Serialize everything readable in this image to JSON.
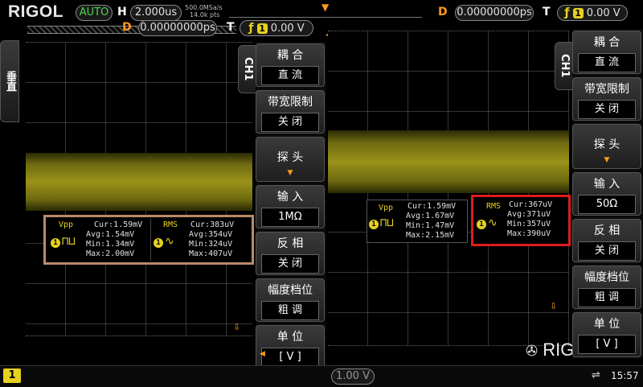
{
  "brand": "RIGOL",
  "top": {
    "mode": "AUTO",
    "h_label": "H",
    "h_value": "2.000us",
    "sample_rate": "500.0MSa/s",
    "mem_depth": "14.0k pts",
    "d_label": "D",
    "d_value": "0.00000000ps",
    "t_label": "T",
    "trig_channel": "1",
    "trig_level": "0.00 V"
  },
  "left_top": {
    "d_label": "D",
    "d_value": "0.00000000ps",
    "t_label": "T",
    "trig_channel": "1",
    "trig_level": "0.00 V"
  },
  "left_tab_vertical": "垂直",
  "menu_left": {
    "ch_tab": "CH1",
    "items": [
      {
        "title": "耦 合",
        "value": "直 流"
      },
      {
        "title": "带宽限制",
        "value": "关 闭"
      },
      {
        "title": "探 头",
        "value": ""
      },
      {
        "title": "输 入",
        "value": "1MΩ"
      },
      {
        "title": "反 相",
        "value": "关 闭"
      },
      {
        "title": "幅度档位",
        "value": "粗 调"
      },
      {
        "title": "单 位",
        "value": "[ V ]"
      }
    ]
  },
  "menu_right": {
    "ch_tab": "CH1",
    "items": [
      {
        "title": "耦 合",
        "value": "直 流"
      },
      {
        "title": "带宽限制",
        "value": "关 闭"
      },
      {
        "title": "探 头",
        "value": ""
      },
      {
        "title": "输 入",
        "value": "50Ω"
      },
      {
        "title": "反 相",
        "value": "关 闭"
      },
      {
        "title": "幅度档位",
        "value": "粗 调"
      },
      {
        "title": "单 位",
        "value": "[ V ]"
      }
    ]
  },
  "meas_left": {
    "vpp": {
      "name": "Vpp",
      "cur": "Cur:1.59mV",
      "avg": "Avg:1.54mV",
      "min": "Min:1.34mV",
      "max": "Max:2.00mV"
    },
    "rms": {
      "name": "RMS",
      "cur": "Cur:383uV",
      "avg": "Avg:354uV",
      "min": "Min:324uV",
      "max": "Max:407uV"
    },
    "border_color": "#b88a6a"
  },
  "meas_right": {
    "vpp": {
      "name": "Vpp",
      "cur": "Cur:1.59mV",
      "avg": "Avg:1.67mV",
      "min": "Min:1.47mV",
      "max": "Max:2.15mV"
    },
    "rms": {
      "name": "RMS",
      "cur": "Cur:367uV",
      "avg": "Avg:371uV",
      "min": "Min:357uV",
      "max": "Max:390uV"
    },
    "highlight_color": "#e01b1b"
  },
  "bottom": {
    "channel": "1",
    "scale": "1.00 V",
    "time": "15:57",
    "usb_icon": "usb-icon"
  },
  "watermark": "RIGOL",
  "colors": {
    "accent": "#e6d21e",
    "trigger": "#ff9a1a",
    "auto": "#4fd64f"
  }
}
